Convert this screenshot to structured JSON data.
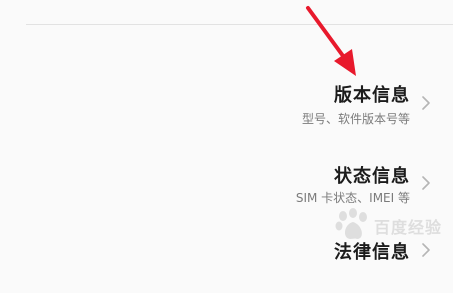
{
  "settings": {
    "items": [
      {
        "title": "版本信息",
        "subtitle": "型号、软件版本号等",
        "icon": "chevron-right-icon"
      },
      {
        "title": "状态信息",
        "subtitle": "SIM 卡状态、IMEI 等",
        "icon": "chevron-right-icon"
      },
      {
        "title": "法律信息",
        "icon": "chevron-right-icon"
      }
    ]
  },
  "annotation": {
    "arrow_color": "#e8192c",
    "icon": "red-arrow-icon"
  },
  "watermark": {
    "text": "百度经验",
    "icon": "baidu-paw-logo"
  },
  "colors": {
    "background": "#fafafa",
    "title": "#1c1c1c",
    "subtitle": "#7b7b7b",
    "chevron": "#b5b5b5",
    "divider": "#e2e2e2"
  }
}
